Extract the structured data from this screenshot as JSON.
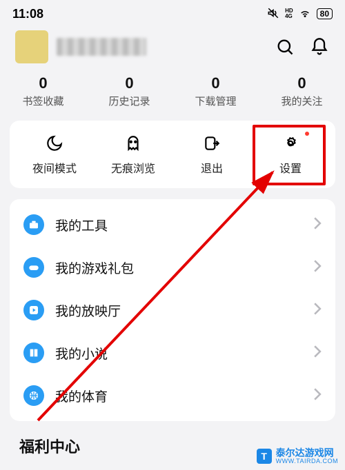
{
  "statusbar": {
    "time": "11:08",
    "battery": "80"
  },
  "header": {
    "username_blurred": true
  },
  "stats": [
    {
      "count": "0",
      "label": "书签收藏"
    },
    {
      "count": "0",
      "label": "历史记录"
    },
    {
      "count": "0",
      "label": "下载管理"
    },
    {
      "count": "0",
      "label": "我的关注"
    }
  ],
  "quick": [
    {
      "label": "夜间模式",
      "icon": "moon-icon"
    },
    {
      "label": "无痕浏览",
      "icon": "ghost-icon"
    },
    {
      "label": "退出",
      "icon": "exit-icon"
    },
    {
      "label": "设置",
      "icon": "settings-icon",
      "highlighted": true
    }
  ],
  "menu": [
    {
      "label": "我的工具",
      "icon": "toolbox-icon"
    },
    {
      "label": "我的游戏礼包",
      "icon": "gamepad-icon"
    },
    {
      "label": "我的放映厅",
      "icon": "play-icon"
    },
    {
      "label": "我的小说",
      "icon": "book-icon"
    },
    {
      "label": "我的体育",
      "icon": "ball-icon"
    }
  ],
  "section_title": "福利中心",
  "watermark": {
    "cn": "泰尔达游戏网",
    "en": "WWW.TAIRDA.COM",
    "badge": "T"
  }
}
